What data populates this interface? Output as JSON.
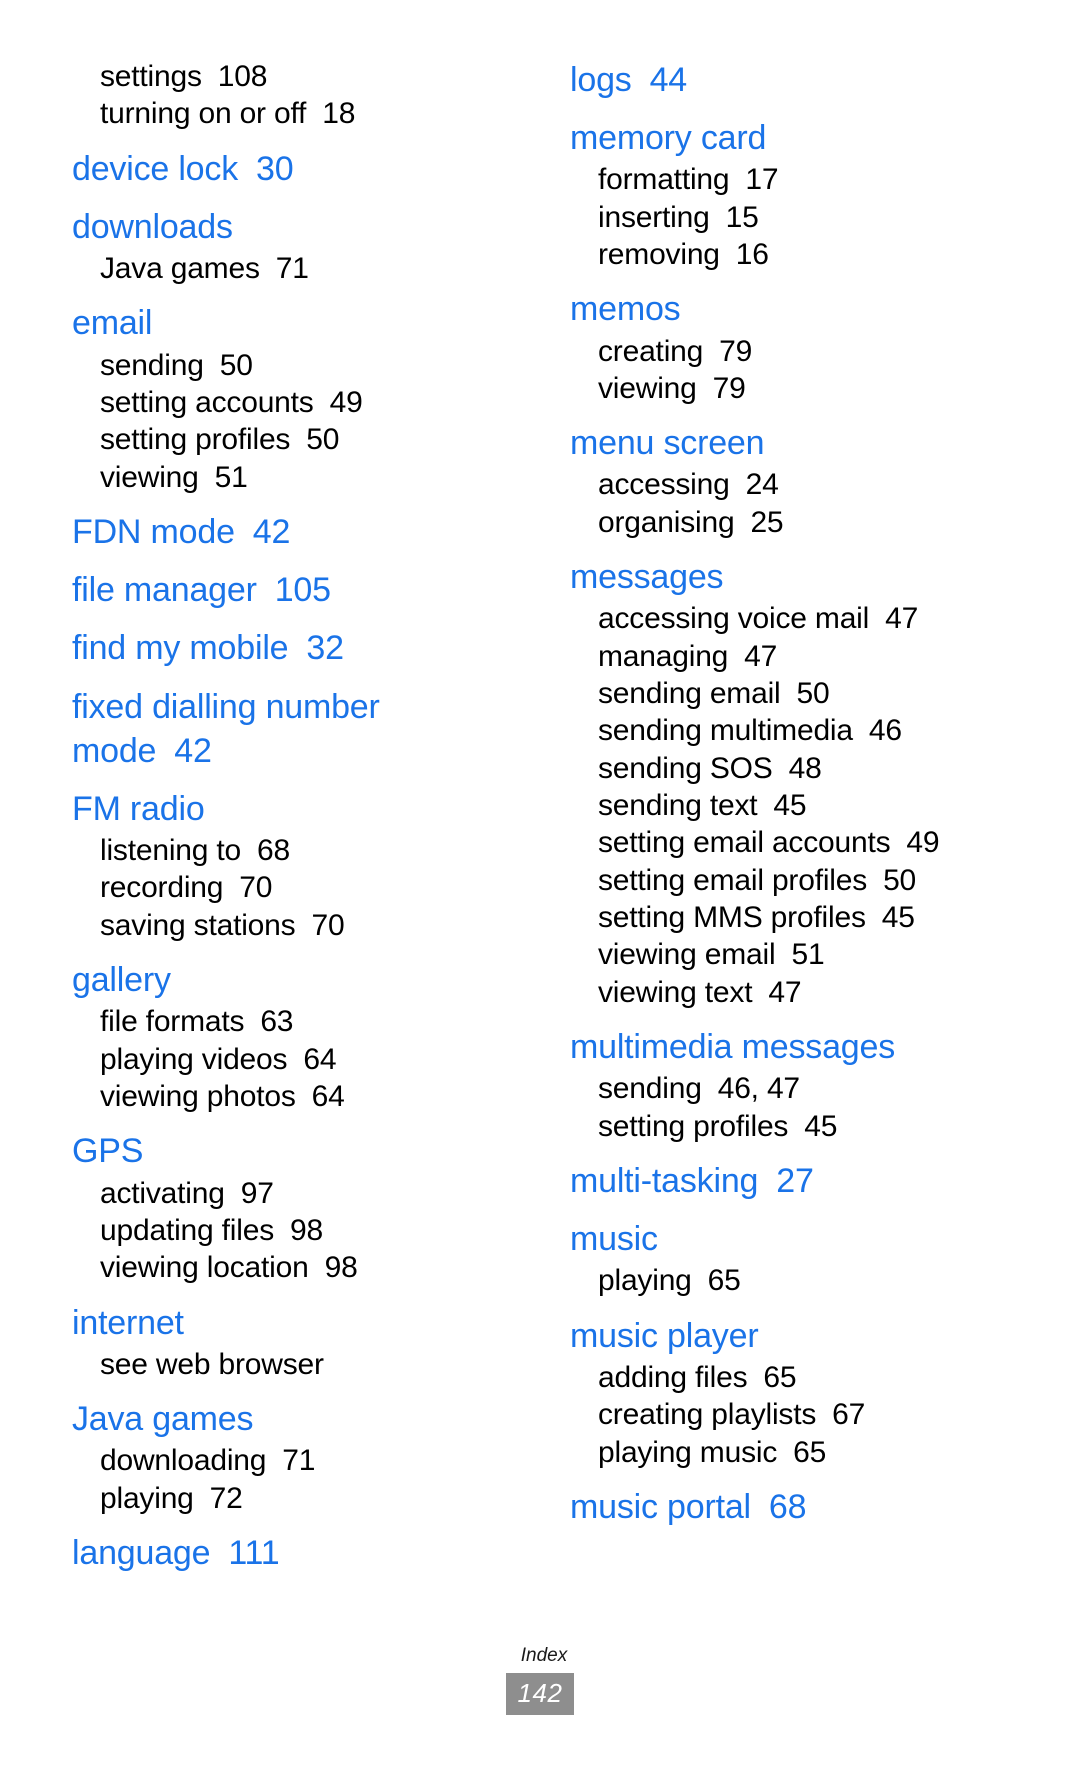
{
  "footer": {
    "section_label": "Index",
    "page_number": "142",
    "badge_color": "#8e8e8e"
  },
  "theme": {
    "headword_color": "#1a73e8",
    "subentry_color": "#000000",
    "background": "#ffffff"
  },
  "columns": [
    {
      "name": "left-column",
      "groups": [
        {
          "headword": null,
          "subentries": [
            {
              "term": "settings",
              "page": "108"
            },
            {
              "term": "turning on or off",
              "page": "18"
            }
          ]
        },
        {
          "headword": {
            "term": "device lock",
            "page": "30"
          },
          "subentries": []
        },
        {
          "headword": {
            "term": "downloads",
            "page": ""
          },
          "subentries": [
            {
              "term": "Java games",
              "page": "71"
            }
          ]
        },
        {
          "headword": {
            "term": "email",
            "page": ""
          },
          "subentries": [
            {
              "term": "sending",
              "page": "50"
            },
            {
              "term": "setting accounts",
              "page": "49"
            },
            {
              "term": "setting profiles",
              "page": "50"
            },
            {
              "term": "viewing",
              "page": "51"
            }
          ]
        },
        {
          "headword": {
            "term": "FDN mode",
            "page": "42"
          },
          "subentries": []
        },
        {
          "headword": {
            "term": "file manager",
            "page": "105"
          },
          "subentries": []
        },
        {
          "headword": {
            "term": "find my mobile",
            "page": "32"
          },
          "subentries": []
        },
        {
          "headword": {
            "term": "fixed dialling number mode",
            "page": "42"
          },
          "subentries": []
        },
        {
          "headword": {
            "term": "FM radio",
            "page": ""
          },
          "subentries": [
            {
              "term": "listening to",
              "page": "68"
            },
            {
              "term": "recording",
              "page": "70"
            },
            {
              "term": "saving stations",
              "page": "70"
            }
          ]
        },
        {
          "headword": {
            "term": "gallery",
            "page": ""
          },
          "subentries": [
            {
              "term": "file formats",
              "page": "63"
            },
            {
              "term": "playing videos",
              "page": "64"
            },
            {
              "term": "viewing photos",
              "page": "64"
            }
          ]
        },
        {
          "headword": {
            "term": "GPS",
            "page": ""
          },
          "subentries": [
            {
              "term": "activating",
              "page": "97"
            },
            {
              "term": "updating files",
              "page": "98"
            },
            {
              "term": "viewing location",
              "page": "98"
            }
          ]
        },
        {
          "headword": {
            "term": "internet",
            "page": ""
          },
          "subentries": [
            {
              "term": "see web browser",
              "page": ""
            }
          ]
        },
        {
          "headword": {
            "term": "Java games",
            "page": ""
          },
          "subentries": [
            {
              "term": "downloading",
              "page": "71"
            },
            {
              "term": "playing",
              "page": "72"
            }
          ]
        },
        {
          "headword": {
            "term": "language",
            "page": "111"
          },
          "subentries": []
        }
      ]
    },
    {
      "name": "right-column",
      "groups": [
        {
          "headword": {
            "term": "logs",
            "page": "44"
          },
          "subentries": []
        },
        {
          "headword": {
            "term": "memory card",
            "page": ""
          },
          "subentries": [
            {
              "term": "formatting",
              "page": "17"
            },
            {
              "term": "inserting",
              "page": "15"
            },
            {
              "term": "removing",
              "page": "16"
            }
          ]
        },
        {
          "headword": {
            "term": "memos",
            "page": ""
          },
          "subentries": [
            {
              "term": "creating",
              "page": "79"
            },
            {
              "term": "viewing",
              "page": "79"
            }
          ]
        },
        {
          "headword": {
            "term": "menu screen",
            "page": ""
          },
          "subentries": [
            {
              "term": "accessing",
              "page": "24"
            },
            {
              "term": "organising",
              "page": "25"
            }
          ]
        },
        {
          "headword": {
            "term": "messages",
            "page": ""
          },
          "subentries": [
            {
              "term": "accessing voice mail",
              "page": "47"
            },
            {
              "term": "managing",
              "page": "47"
            },
            {
              "term": "sending email",
              "page": "50"
            },
            {
              "term": "sending multimedia",
              "page": "46"
            },
            {
              "term": "sending SOS",
              "page": "48"
            },
            {
              "term": "sending text",
              "page": "45"
            },
            {
              "term": "setting email accounts",
              "page": "49"
            },
            {
              "term": "setting email profiles",
              "page": "50"
            },
            {
              "term": "setting MMS profiles",
              "page": "45"
            },
            {
              "term": "viewing email",
              "page": "51"
            },
            {
              "term": "viewing text",
              "page": "47"
            }
          ]
        },
        {
          "headword": {
            "term": "multimedia messages",
            "page": ""
          },
          "subentries": [
            {
              "term": "sending",
              "page": "46, 47"
            },
            {
              "term": "setting profiles",
              "page": "45"
            }
          ]
        },
        {
          "headword": {
            "term": "multi-tasking",
            "page": "27"
          },
          "subentries": []
        },
        {
          "headword": {
            "term": "music",
            "page": ""
          },
          "subentries": [
            {
              "term": "playing",
              "page": "65"
            }
          ]
        },
        {
          "headword": {
            "term": "music player",
            "page": ""
          },
          "subentries": [
            {
              "term": "adding files",
              "page": "65"
            },
            {
              "term": "creating playlists",
              "page": "67"
            },
            {
              "term": "playing music",
              "page": "65"
            }
          ]
        },
        {
          "headword": {
            "term": "music portal",
            "page": "68"
          },
          "subentries": []
        }
      ]
    }
  ]
}
